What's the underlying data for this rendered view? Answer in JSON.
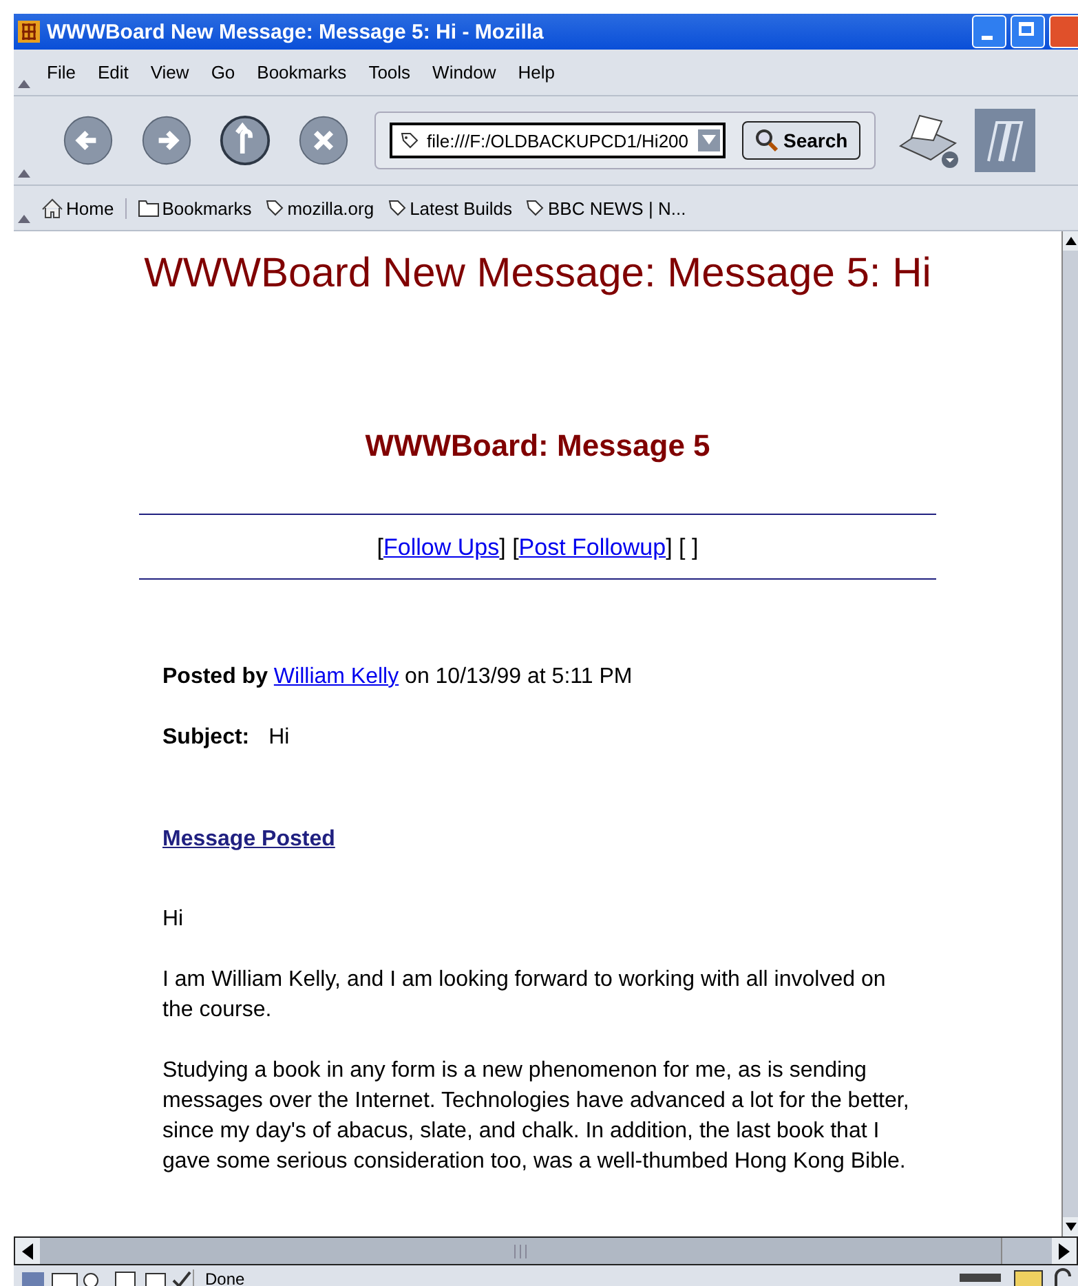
{
  "window": {
    "title": "WWWBoard New Message: Message 5: Hi - Mozilla"
  },
  "menu": [
    "File",
    "Edit",
    "View",
    "Go",
    "Bookmarks",
    "Tools",
    "Window",
    "Help"
  ],
  "toolbar": {
    "address": "file:///F:/OLDBACKUPCD1/Hi200",
    "search_button": "Search"
  },
  "bookmarks_bar": [
    {
      "kind": "home",
      "label": "Home"
    },
    {
      "kind": "folder",
      "label": "Bookmarks"
    },
    {
      "kind": "link",
      "label": "mozilla.org"
    },
    {
      "kind": "link",
      "label": "Latest Builds"
    },
    {
      "kind": "link",
      "label": "BBC NEWS | N..."
    }
  ],
  "page": {
    "title": "WWWBoard New Message: Message 5: Hi",
    "heading": "WWWBoard: Message 5",
    "nav": [
      {
        "kind": "text",
        "text": "["
      },
      {
        "kind": "link",
        "text": "Follow Ups"
      },
      {
        "kind": "text",
        "text": "] ["
      },
      {
        "kind": "link",
        "text": "Post Followup"
      },
      {
        "kind": "text",
        "text": "] [ ]"
      }
    ],
    "posted_by": {
      "label": "Posted by",
      "name": "William Kelly",
      "date": "on 10/13/99 at 5:11 PM"
    },
    "subject": {
      "label": "Subject:",
      "value": "Hi"
    },
    "section_link": "Message Posted",
    "paragraphs": [
      "Hi",
      "I am William Kelly, and I am looking forward to working with all involved on the course.",
      "Studying a book in any form is a new phenomenon for me, as is sending messages over the Internet. Technologies have advanced a lot for the better, since my day's of abacus, slate, and chalk. In addition, the last book that I gave some serious consideration too, was a well-thumbed Hong Kong Bible."
    ]
  },
  "status_bar": {
    "text": "Done"
  }
}
